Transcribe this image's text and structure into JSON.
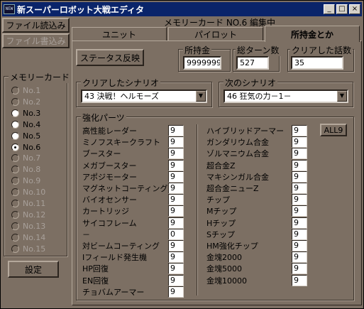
{
  "window": {
    "title": "新スーパーロボット大戦エディタ",
    "app_icon_label": "NEW",
    "minimize_label": "_",
    "maximize_label": "□",
    "close_label": "×"
  },
  "sidebar": {
    "load_button": "ファイル読込み",
    "save_button": "ファイル書込み",
    "memory_group_label": "メモリーカード",
    "items": [
      {
        "label": "No.1",
        "enabled": false,
        "checked": false
      },
      {
        "label": "No.2",
        "enabled": false,
        "checked": false
      },
      {
        "label": "No.3",
        "enabled": true,
        "checked": false
      },
      {
        "label": "No.4",
        "enabled": true,
        "checked": false
      },
      {
        "label": "No.5",
        "enabled": true,
        "checked": false
      },
      {
        "label": "No.6",
        "enabled": true,
        "checked": true
      },
      {
        "label": "No.7",
        "enabled": false,
        "checked": false
      },
      {
        "label": "No.8",
        "enabled": false,
        "checked": false
      },
      {
        "label": "No.9",
        "enabled": false,
        "checked": false
      },
      {
        "label": "No.10",
        "enabled": false,
        "checked": false
      },
      {
        "label": "No.11",
        "enabled": false,
        "checked": false
      },
      {
        "label": "No.12",
        "enabled": false,
        "checked": false
      },
      {
        "label": "No.13",
        "enabled": false,
        "checked": false
      },
      {
        "label": "No.14",
        "enabled": false,
        "checked": false
      },
      {
        "label": "No.15",
        "enabled": false,
        "checked": false
      }
    ],
    "settings_button": "設定"
  },
  "status": {
    "editing_label": "メモリーカード NO.6 編集中"
  },
  "tabs": [
    {
      "label": "ユニット",
      "active": false
    },
    {
      "label": "パイロット",
      "active": false
    },
    {
      "label": "所持金とか",
      "active": true
    }
  ],
  "panel": {
    "status_reflect_button": "ステータス反映",
    "money": {
      "label": "所持金",
      "value": "9999999"
    },
    "turns": {
      "label": "総ターン数",
      "value": "527"
    },
    "cleared": {
      "label": "クリアした話数",
      "value": "35"
    },
    "cleared_scenario": {
      "label": "クリアしたシナリオ",
      "value": "43 決戦！ヘルモーズ"
    },
    "next_scenario": {
      "label": "次のシナリオ",
      "value": "46 狂気の力－1－"
    },
    "parts_group_label": "強化パーツ",
    "all9_button": "ALL9",
    "parts_left": [
      {
        "name": "高性能レーダー",
        "value": "9"
      },
      {
        "name": "ミノフスキークラフト",
        "value": "9"
      },
      {
        "name": "ブースター",
        "value": "9"
      },
      {
        "name": "メガブースター",
        "value": "9"
      },
      {
        "name": "アポジモーター",
        "value": "9"
      },
      {
        "name": "マグネットコーティング",
        "value": "9"
      },
      {
        "name": "バイオセンサー",
        "value": "9"
      },
      {
        "name": "カートリッジ",
        "value": "9"
      },
      {
        "name": "サイコフレーム",
        "value": "9"
      },
      {
        "name": "－",
        "value": "0"
      },
      {
        "name": "対ビームコーティング",
        "value": "9"
      },
      {
        "name": "Iフィールド発生機",
        "value": "9"
      },
      {
        "name": "HP回復",
        "value": "9"
      },
      {
        "name": "EN回復",
        "value": "9"
      },
      {
        "name": "チョバムアーマー",
        "value": "9"
      }
    ],
    "parts_right": [
      {
        "name": "ハイブリッドアーマー",
        "value": "9"
      },
      {
        "name": "ガンダリウム合金",
        "value": "9"
      },
      {
        "name": "ゾルマニウム合金",
        "value": "9"
      },
      {
        "name": "超合金Z",
        "value": "9"
      },
      {
        "name": "マキシンガル合金",
        "value": "9"
      },
      {
        "name": "超合金ニューZ",
        "value": "9"
      },
      {
        "name": "チップ",
        "value": "9"
      },
      {
        "name": "Mチップ",
        "value": "9"
      },
      {
        "name": "Hチップ",
        "value": "9"
      },
      {
        "name": "Sチップ",
        "value": "9"
      },
      {
        "name": "HM強化チップ",
        "value": "9"
      },
      {
        "name": "金塊2000",
        "value": "9"
      },
      {
        "name": "金塊5000",
        "value": "9"
      },
      {
        "name": "金塊10000",
        "value": "9"
      }
    ]
  }
}
